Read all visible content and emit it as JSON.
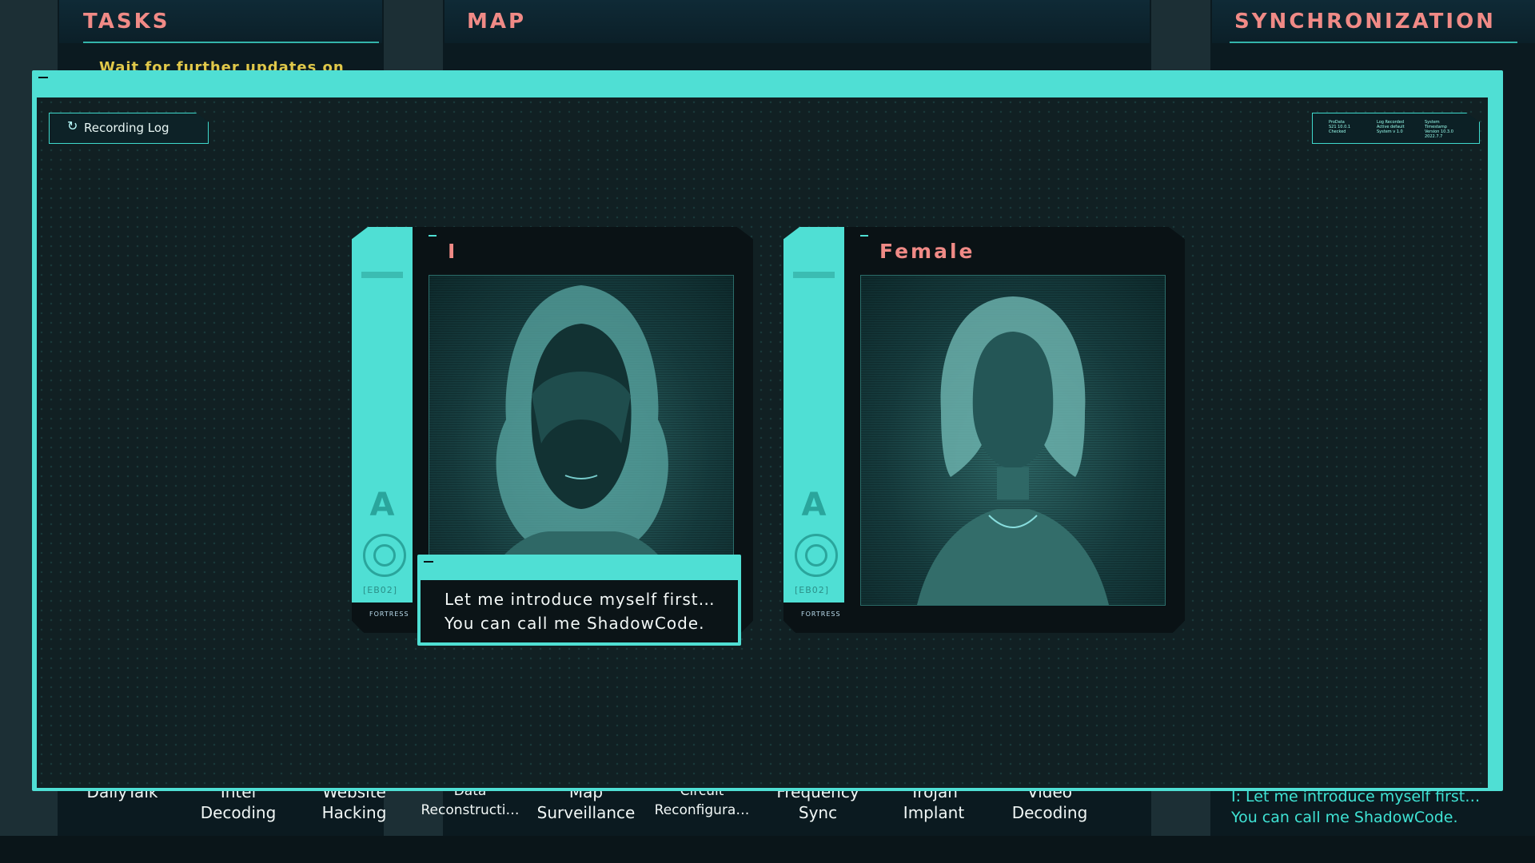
{
  "panels": {
    "tasks_title": "TASKS",
    "map_title": "MAP",
    "sync_title": "SYNCHRONIZATION",
    "task_item": "Wait for further updates on"
  },
  "apps": [
    {
      "label": "DailyTalk",
      "small": false
    },
    {
      "label": "Intel\nDecoding",
      "small": false
    },
    {
      "label": "Website\nHacking",
      "small": false
    },
    {
      "label": "Data\nReconstructi…",
      "small": true
    },
    {
      "label": "Map\nSurveillance",
      "small": false
    },
    {
      "label": "Circuit\nReconfigura…",
      "small": true
    },
    {
      "label": "Frequency\nSync",
      "small": false
    },
    {
      "label": "Trojan\nImplant",
      "small": false
    },
    {
      "label": "Video\nDecoding",
      "small": false
    }
  ],
  "sync_log": {
    "line1": "I: Let me introduce myself first…",
    "line2": "You can call me ShadowCode."
  },
  "modal": {
    "recording_log_label": "Recording Log",
    "status_items": [
      "ProData\nS21 10.0.1\nChecked",
      "Log Recorded\nActive default\nSystem v 1.0",
      "System\nTimestamp\nVersion 10.3.0\n2022.7.7"
    ]
  },
  "cards": {
    "left": {
      "name": "I",
      "code": "[EB02]",
      "footer": "FORTRESS",
      "logo": "A"
    },
    "right": {
      "name": "Female",
      "code": "[EB02]",
      "footer": "FORTRESS",
      "logo": "A"
    }
  },
  "dialogue": {
    "line1": "Let me introduce myself first…",
    "line2": "You can call me ShadowCode."
  },
  "icons": {
    "recording": "refresh-icon",
    "portrait_left": "hooded-figure-portrait",
    "portrait_right": "woman-portrait"
  },
  "colors": {
    "accent": "#4fdfd4",
    "title": "#f08a86",
    "task_text": "#e0c84a",
    "background": "#101a1e"
  }
}
